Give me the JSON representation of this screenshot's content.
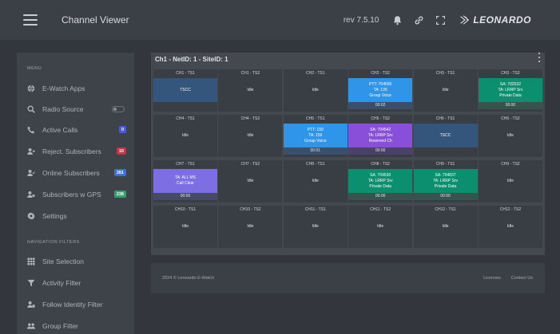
{
  "header": {
    "title": "Channel Viewer",
    "version": "rev 7.5.10",
    "brand": "LEONARDO",
    "icons": [
      "menu-icon",
      "bell-icon",
      "link-icon",
      "fullscreen-icon",
      "leonardo-logo"
    ]
  },
  "sidebar": {
    "menu_heading": "MENU",
    "menu_items": [
      {
        "label": "E-Watch Apps",
        "icon": "globe-icon"
      },
      {
        "label": "Radio Source",
        "icon": "search-icon",
        "toggle": true
      },
      {
        "label": "Active Calls",
        "icon": "phone-icon",
        "badge": "0",
        "badge_color": "#4b5bd6"
      },
      {
        "label": "Reject. Subscribers",
        "icon": "user-x-icon",
        "badge": "10",
        "badge_color": "#c8324b"
      },
      {
        "label": "Online Subscribers",
        "icon": "user-check-icon",
        "badge": "281",
        "badge_color": "#3d6fd8"
      },
      {
        "label": "Subscribers w GPS",
        "icon": "users-gps-icon",
        "badge": "238",
        "badge_color": "#31a26a"
      },
      {
        "label": "Settings",
        "icon": "gear-icon"
      }
    ],
    "nav_heading": "NAVIGATION FILTERS",
    "nav_items": [
      {
        "label": "Site Selection",
        "icon": "grid-icon"
      },
      {
        "label": "Activity Filter",
        "icon": "filter-icon"
      },
      {
        "label": "Follow Identity Filter",
        "icon": "user-follow-icon"
      },
      {
        "label": "Group Filter",
        "icon": "group-icon"
      }
    ]
  },
  "panel": {
    "title": "Ch1 - NetID: 1 - SiteID: 1",
    "cells": [
      {
        "head": "CH1 - TS1",
        "lines": [
          "TSCC"
        ],
        "state": "tscc"
      },
      {
        "head": "CH1 - TS2",
        "lines": [
          "Idle"
        ],
        "state": "idle"
      },
      {
        "head": "CH2 - TS1",
        "lines": [
          "Idle"
        ],
        "state": "idle"
      },
      {
        "head": "CH2 - TS2",
        "lines": [
          "PTT: 704555",
          "TA: 135",
          "Group Voice"
        ],
        "timer": "00:02",
        "state": "blue"
      },
      {
        "head": "CH3 - TS1",
        "lines": [
          "Idle"
        ],
        "state": "idle"
      },
      {
        "head": "CH3 - TS2",
        "lines": [
          "SA: 702532",
          "TA: LRRP Srv",
          "Private Data"
        ],
        "timer": "00:00",
        "state": "green"
      },
      {
        "head": "CH4 - TS1",
        "lines": [
          "Idle"
        ],
        "state": "idle"
      },
      {
        "head": "CH4 - TS2",
        "lines": [
          "Idle"
        ],
        "state": "idle"
      },
      {
        "head": "CH5 - TS1",
        "lines": [
          "PTT: 159",
          "TA: 159",
          "Group Voice"
        ],
        "timer": "00:01",
        "state": "blue"
      },
      {
        "head": "CH5 - TS2",
        "lines": [
          "SA: 704542",
          "TA: LRRP Srv",
          "Reserved Ch"
        ],
        "timer": "00:00",
        "state": "purple"
      },
      {
        "head": "CH6 - TS1",
        "lines": [
          "TSCC"
        ],
        "state": "tscc"
      },
      {
        "head": "CH6 - TS2",
        "lines": [
          "Idle"
        ],
        "state": "idle"
      },
      {
        "head": "CH7 - TS1",
        "lines": [
          "TA: ALL MS",
          "Call Clear"
        ],
        "timer": "00:00",
        "state": "lavender"
      },
      {
        "head": "CH7 - TS2",
        "lines": [
          "Idle"
        ],
        "state": "idle"
      },
      {
        "head": "CH8 - TS1",
        "lines": [
          "Idle"
        ],
        "state": "idle"
      },
      {
        "head": "CH8 - TS2",
        "lines": [
          "SA: 704530",
          "TA: LRRP Srv",
          "Private Data"
        ],
        "timer": "00:00",
        "state": "green"
      },
      {
        "head": "CH9 - TS1",
        "lines": [
          "SA: 704837",
          "TA: LRRP Srv",
          "Private Data"
        ],
        "timer": "00:00",
        "state": "green"
      },
      {
        "head": "CH9 - TS2",
        "lines": [
          "Idle"
        ],
        "state": "idle"
      },
      {
        "head": "CH10 - TS1",
        "lines": [
          "Idle"
        ],
        "state": "idle"
      },
      {
        "head": "CH10 - TS2",
        "lines": [
          "Idle"
        ],
        "state": "idle"
      },
      {
        "head": "CH11 - TS1",
        "lines": [
          "Idle"
        ],
        "state": "idle"
      },
      {
        "head": "CH11 - TS2",
        "lines": [
          "Idle"
        ],
        "state": "idle"
      },
      {
        "head": "CH12 - TS1",
        "lines": [
          "Idle"
        ],
        "state": "idle"
      },
      {
        "head": "CH12 - TS2",
        "lines": [
          "Idle"
        ],
        "state": "idle"
      }
    ]
  },
  "footer": {
    "copyright": "2024 © Leonardo E-Watch",
    "links": [
      "Licenses",
      "Contact Us"
    ]
  }
}
